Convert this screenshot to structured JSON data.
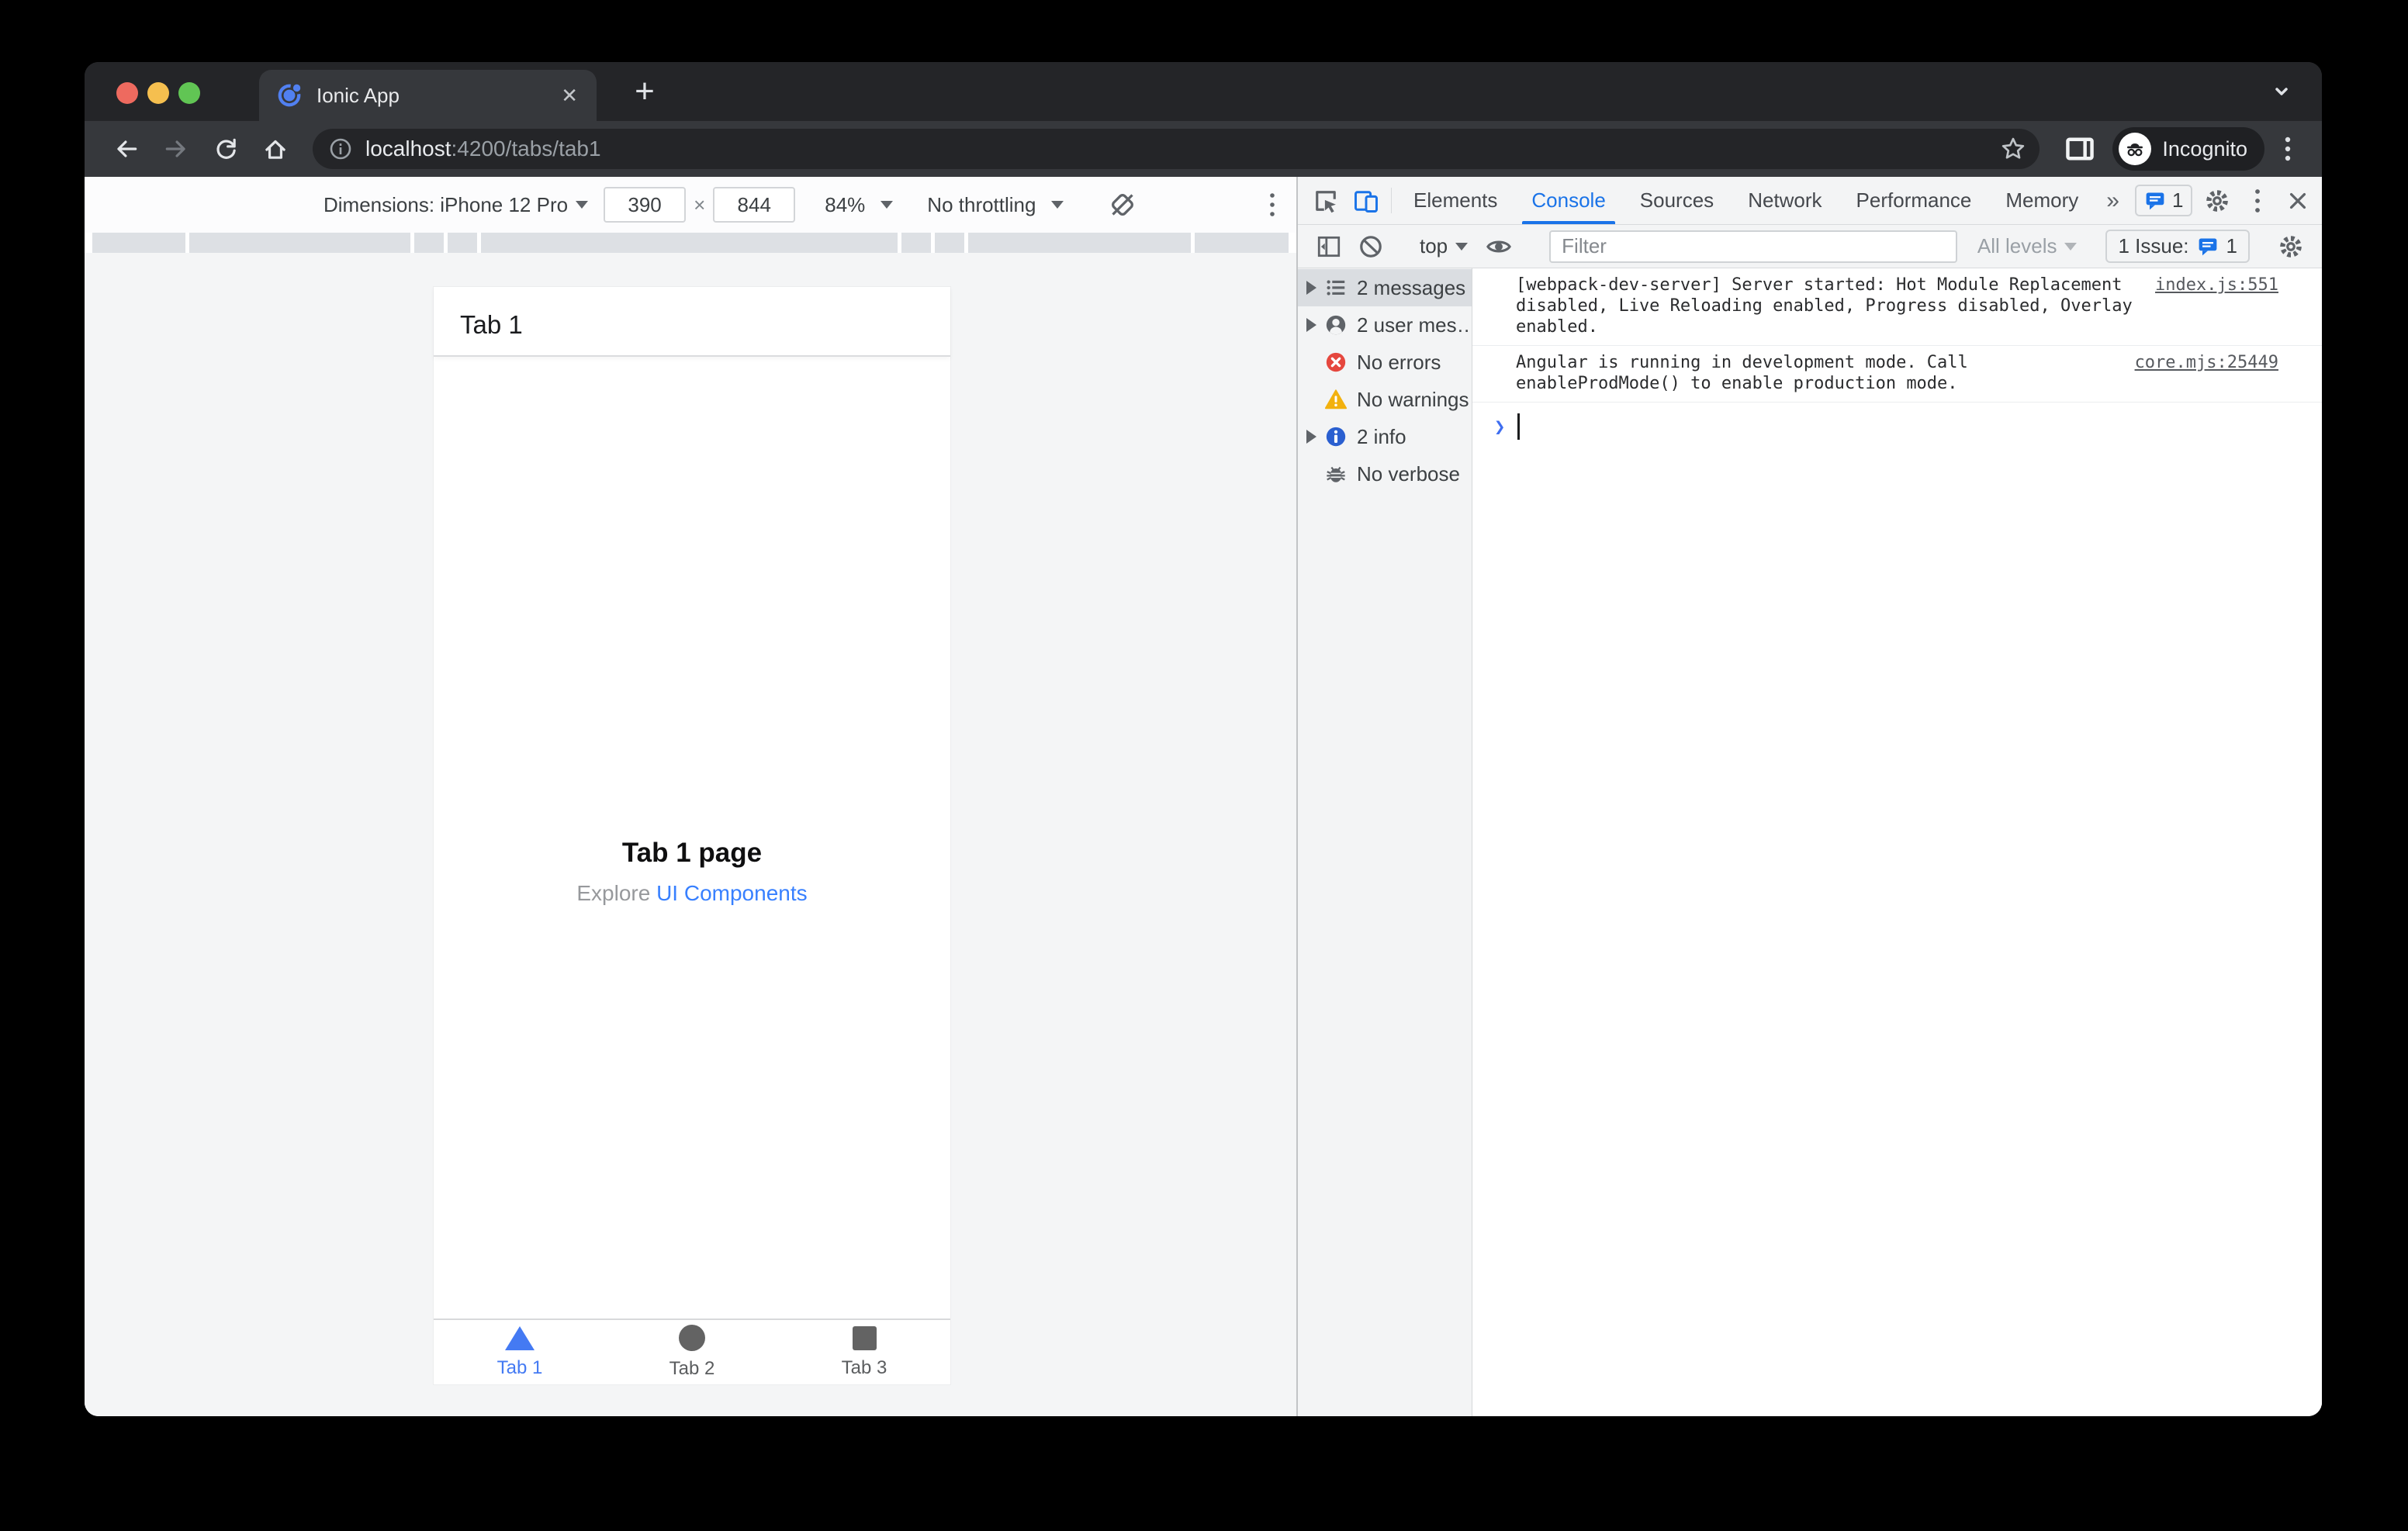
{
  "titlebar": {
    "tab_title": "Ionic App",
    "close_glyph": "✕",
    "new_tab_glyph": "+"
  },
  "addressbar": {
    "host": "localhost",
    "path": ":4200/tabs/tab1",
    "incognito_label": "Incognito"
  },
  "device_toolbar": {
    "dimensions_label": "Dimensions: iPhone 12 Pro",
    "width_value": "390",
    "times_glyph": "×",
    "height_value": "844",
    "zoom_value": "84%",
    "throttling_label": "No throttling"
  },
  "app": {
    "header_title": "Tab 1",
    "page_title": "Tab 1 page",
    "subtitle_prefix": "Explore ",
    "subtitle_link": "UI Components",
    "tabs": [
      {
        "label": "Tab 1",
        "icon": "triangle",
        "active": true
      },
      {
        "label": "Tab 2",
        "icon": "circle",
        "active": false
      },
      {
        "label": "Tab 3",
        "icon": "square",
        "active": false
      }
    ]
  },
  "devtools": {
    "tabs": [
      "Elements",
      "Console",
      "Sources",
      "Network",
      "Performance",
      "Memory"
    ],
    "active_tab": "Console",
    "more_tabs_glyph": "»",
    "tab_issue_count": "1",
    "console_toolbar": {
      "context_label": "top",
      "filter_placeholder": "Filter",
      "levels_label": "All levels",
      "issue_label": "1 Issue:",
      "issue_count": "1"
    },
    "sidebar": [
      {
        "icon": "list",
        "label": "2 messages",
        "selected": true,
        "expandable": true
      },
      {
        "icon": "user",
        "label": "2 user mes…",
        "expandable": true
      },
      {
        "icon": "error",
        "label": "No errors"
      },
      {
        "icon": "warning",
        "label": "No warnings"
      },
      {
        "icon": "info",
        "label": "2 info",
        "expandable": true
      },
      {
        "icon": "bug",
        "label": "No verbose"
      }
    ],
    "messages": [
      {
        "text": "[webpack-dev-server] Server started: Hot Module Replacement disabled, Live Reloading enabled, Progress disabled, Overlay enabled.",
        "source": "index.js:551"
      },
      {
        "text": "Angular is running in development mode. Call enableProdMode() to enable production mode.",
        "source": "core.mjs:25449"
      }
    ],
    "prompt_glyph": "❯"
  },
  "colors": {
    "accent_blue": "#1a73e8",
    "ionic_link": "#3880ff",
    "error_red": "#e5473e",
    "warning_yellow": "#f2b10e",
    "info_blue": "#2a5fd0",
    "active_tab_blue": "#447af3"
  }
}
